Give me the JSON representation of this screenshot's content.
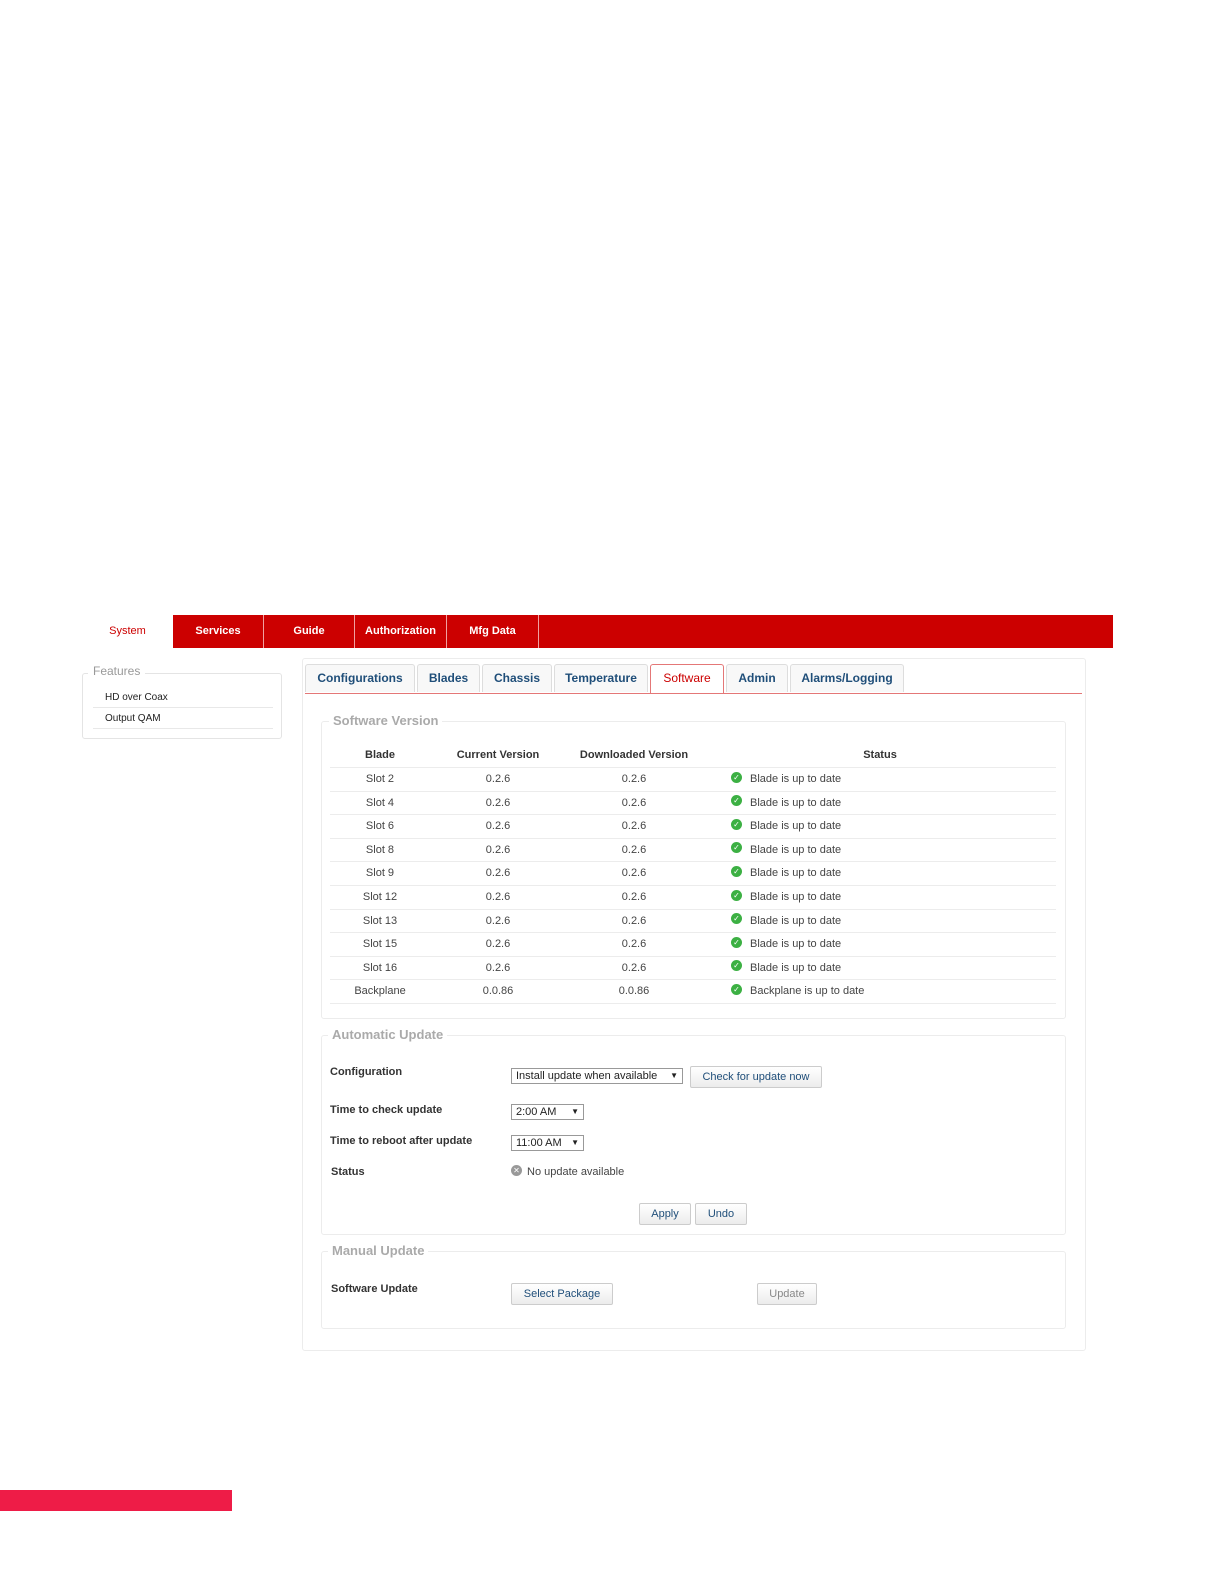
{
  "topnav": {
    "tabs": [
      {
        "label": "System",
        "active": true
      },
      {
        "label": "Services",
        "active": false
      },
      {
        "label": "Guide",
        "active": false
      },
      {
        "label": "Authorization",
        "active": false
      },
      {
        "label": "Mfg Data",
        "active": false
      }
    ]
  },
  "sidebar": {
    "title": "Features",
    "items": [
      "HD over Coax",
      "Output QAM"
    ]
  },
  "subtabs": [
    {
      "label": "Configurations",
      "active": false
    },
    {
      "label": "Blades",
      "active": false
    },
    {
      "label": "Chassis",
      "active": false
    },
    {
      "label": "Temperature",
      "active": false
    },
    {
      "label": "Software",
      "active": true
    },
    {
      "label": "Admin",
      "active": false
    },
    {
      "label": "Alarms/Logging",
      "active": false
    }
  ],
  "software_version": {
    "legend": "Software Version",
    "columns": {
      "blade": "Blade",
      "current": "Current Version",
      "downloaded": "Downloaded Version",
      "status": "Status"
    },
    "rows": [
      {
        "blade": "Slot 2",
        "current": "0.2.6",
        "downloaded": "0.2.6",
        "status": "Blade is up to date"
      },
      {
        "blade": "Slot 4",
        "current": "0.2.6",
        "downloaded": "0.2.6",
        "status": "Blade is up to date"
      },
      {
        "blade": "Slot 6",
        "current": "0.2.6",
        "downloaded": "0.2.6",
        "status": "Blade is up to date"
      },
      {
        "blade": "Slot 8",
        "current": "0.2.6",
        "downloaded": "0.2.6",
        "status": "Blade is up to date"
      },
      {
        "blade": "Slot 9",
        "current": "0.2.6",
        "downloaded": "0.2.6",
        "status": "Blade is up to date"
      },
      {
        "blade": "Slot 12",
        "current": "0.2.6",
        "downloaded": "0.2.6",
        "status": "Blade is up to date"
      },
      {
        "blade": "Slot 13",
        "current": "0.2.6",
        "downloaded": "0.2.6",
        "status": "Blade is up to date"
      },
      {
        "blade": "Slot 15",
        "current": "0.2.6",
        "downloaded": "0.2.6",
        "status": "Blade is up to date"
      },
      {
        "blade": "Slot 16",
        "current": "0.2.6",
        "downloaded": "0.2.6",
        "status": "Blade is up to date"
      },
      {
        "blade": "Backplane",
        "current": "0.0.86",
        "downloaded": "0.0.86",
        "status": "Backplane is up to date"
      }
    ]
  },
  "automatic_update": {
    "legend": "Automatic Update",
    "configuration_label": "Configuration",
    "configuration_value": "Install update when available",
    "check_button": "Check for update now",
    "time_check_label": "Time to check update",
    "time_check_value": "2:00 AM",
    "time_reboot_label": "Time to reboot after update",
    "time_reboot_value": "11:00 AM",
    "status_label": "Status",
    "status_value": "No update available",
    "apply_button": "Apply",
    "undo_button": "Undo"
  },
  "manual_update": {
    "legend": "Manual Update",
    "software_update_label": "Software Update",
    "select_button": "Select Package",
    "update_button": "Update"
  },
  "colors": {
    "brand_red": "#cc0000",
    "accent_pink": "#ee1c47",
    "ok_green": "#3cb043"
  }
}
